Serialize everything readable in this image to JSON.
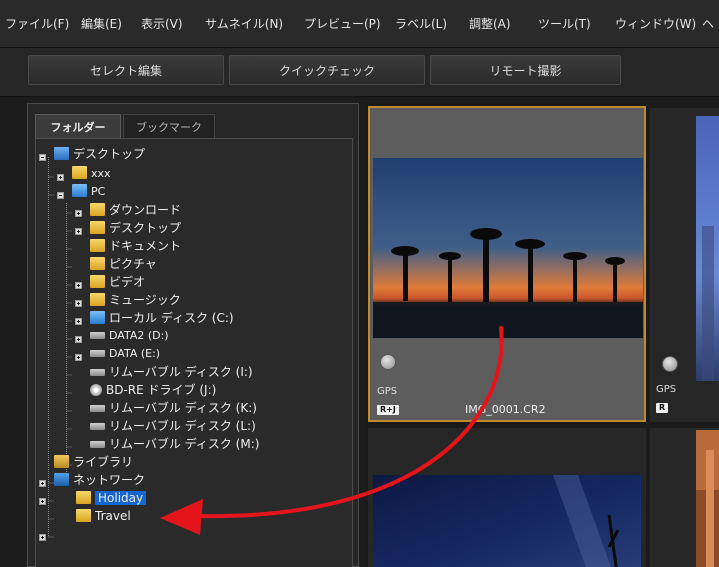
{
  "menu": [
    "ファイル(F)",
    "編集(E)",
    "表示(V)",
    "サムネイル(N)",
    "プレビュー(P)",
    "ラベル(L)",
    "調整(A)",
    "ツール(T)",
    "ウィンドウ(W)",
    "ヘ"
  ],
  "toolbar": {
    "select_edit": "セレクト編集",
    "quick_check": "クイックチェック",
    "remote": "リモート撮影"
  },
  "tabs": {
    "folder": "フォルダー",
    "bookmark": "ブックマーク"
  },
  "tree": {
    "desktop": "デスクトップ",
    "xxx": "xxx",
    "pc": "PC",
    "downloads": "ダウンロード",
    "desktop2": "デスクトップ",
    "documents": "ドキュメント",
    "pictures": "ピクチャ",
    "videos": "ビデオ",
    "music": "ミュージック",
    "local_c": "ローカル ディスク (C:)",
    "data2_d": "DATA2 (D:)",
    "data_e": "DATA (E:)",
    "removable_i": "リムーバブル ディスク (I:)",
    "bdre_j": "BD-RE ドライブ (J:)",
    "removable_k": "リムーバブル ディスク (K:)",
    "removable_l": "リムーバブル ディスク (L:)",
    "removable_m": "リムーバブル ディスク (M:)",
    "library": "ライブラリ",
    "network": "ネットワーク",
    "holiday": "Holiday",
    "travel": "Travel"
  },
  "thumbs": {
    "t1": {
      "gps": "GPS",
      "badge": "R+J",
      "filename": "IMG_0001.CR2"
    },
    "t2": {
      "gps": "GPS",
      "badge": "R"
    }
  },
  "colors": {
    "selection": "#1565d2",
    "thumb_border": "#c08a2f",
    "arrow": "#e4141b"
  }
}
